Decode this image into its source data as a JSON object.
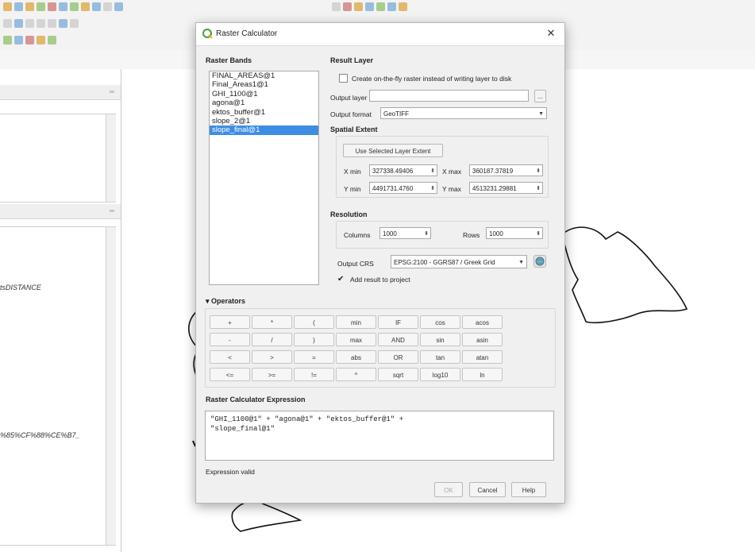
{
  "dialog": {
    "title": "Raster Calculator",
    "raster_bands": {
      "heading": "Raster Bands",
      "items": [
        "FINAL_AREAS@1",
        "Final_Areas1@1",
        "GHI_1100@1",
        "agona@1",
        "ektos_buffer@1",
        "slope_2@1",
        "slope_final@1"
      ],
      "selected": "slope_final@1"
    },
    "result_layer": {
      "heading": "Result Layer",
      "onthefly_label": "Create on-the-fly raster instead of writing layer to disk",
      "output_layer_label": "Output layer",
      "output_layer_value": "",
      "browse_label": "...",
      "output_format_label": "Output format",
      "output_format_value": "GeoTIFF"
    },
    "spatial_extent": {
      "heading": "Spatial Extent",
      "use_selected_label": "Use Selected Layer Extent",
      "xmin_label": "X min",
      "xmin_value": "327338.49406",
      "xmax_label": "X max",
      "xmax_value": "360187.37819",
      "ymin_label": "Y min",
      "ymin_value": "4491731.4760",
      "ymax_label": "Y max",
      "ymax_value": "4513231.29881"
    },
    "resolution": {
      "heading": "Resolution",
      "columns_label": "Columns",
      "columns_value": "1000",
      "rows_label": "Rows",
      "rows_value": "1000",
      "crs_label": "Output CRS",
      "crs_value": "EPSG:2100 - GGRS87 / Greek Grid",
      "add_result_label": "Add result to project"
    },
    "operators": {
      "heading": "Operators",
      "rows": [
        [
          "+",
          "*",
          "(",
          "min",
          "IF",
          "cos",
          "acos"
        ],
        [
          "-",
          "/",
          ")",
          "max",
          "AND",
          "sin",
          "asin"
        ],
        [
          "<",
          ">",
          "=",
          "abs",
          "OR",
          "tan",
          "atan"
        ],
        [
          "<=",
          ">=",
          "!=",
          "^",
          "sqrt",
          "log10",
          "ln"
        ]
      ]
    },
    "expression": {
      "heading": "Raster Calculator Expression",
      "text": "\"GHI_1100@1\" + \"agona@1\" + \"ektos_buffer@1\" +\n\"slope_final@1\""
    },
    "status": "Expression valid",
    "buttons": {
      "ok": "OK",
      "cancel": "Cancel",
      "help": "Help"
    }
  },
  "background": {
    "left_panel_text_1": "tsDISTANCE",
    "left_panel_text_2": "%85%CF%88%CE%B7_"
  }
}
